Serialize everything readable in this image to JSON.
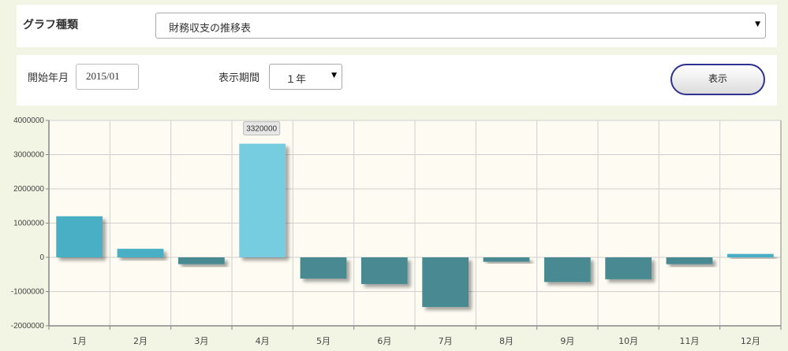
{
  "form": {
    "graph_type_label": "グラフ種類",
    "graph_type_value": "財務収支の推移表",
    "start_month_label": "開始年月",
    "start_month_value": "2015/01",
    "period_label": "表示期間",
    "period_value": "１年",
    "show_button": "表示"
  },
  "chart_data": {
    "type": "bar",
    "categories": [
      "1月",
      "2月",
      "3月",
      "4月",
      "5月",
      "6月",
      "7月",
      "8月",
      "9月",
      "10月",
      "11月",
      "12月"
    ],
    "values": [
      1200000,
      250000,
      -200000,
      3320000,
      -620000,
      -780000,
      -1450000,
      -130000,
      -720000,
      -640000,
      -200000,
      100000
    ],
    "ylim": [
      -2000000,
      4000000
    ],
    "yticks": [
      -2000000,
      -1000000,
      0,
      1000000,
      2000000,
      3000000,
      4000000
    ],
    "ytick_labels": [
      "-2000000",
      "-1000000",
      "0",
      "1000000",
      "2000000",
      "3000000",
      "4000000"
    ],
    "data_label": {
      "index": 3,
      "text": "3320000"
    },
    "grid": true,
    "colors": {
      "positive": "#4aafc4",
      "positive_highlight": "#76cde0",
      "negative": "#4a8a92",
      "plot_bg": "#fdfbf2",
      "grid": "#cfcfcf"
    }
  }
}
